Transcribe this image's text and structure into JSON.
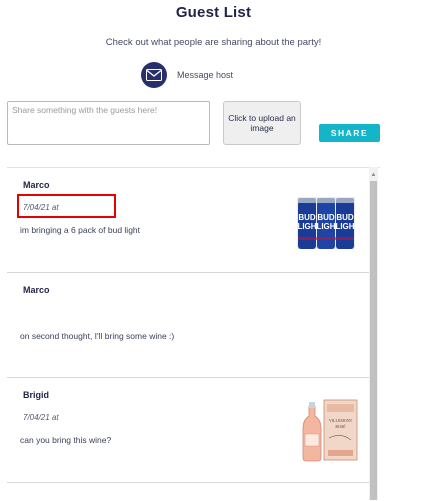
{
  "page": {
    "title": "Guest List",
    "subtitle": "Check out what people are sharing about the party!"
  },
  "message_host": {
    "label": "Message host",
    "icon": "envelope-icon",
    "icon_color": "#27306d"
  },
  "compose": {
    "placeholder": "Share something with the guests here!",
    "value": "",
    "upload_label": "Click to upload an image",
    "share_label": "SHARE",
    "share_color": "#15b5c9"
  },
  "posts": [
    {
      "author": "Marco",
      "timestamp": "7/04/21 at",
      "text": "im bringing a 6 pack of bud light",
      "image": "beer-six-pack-image",
      "highlighted": true
    },
    {
      "author": "Marco",
      "timestamp": "",
      "text": "on second thought, I'll bring some wine :)",
      "image": null,
      "highlighted": false
    },
    {
      "author": "Brigid",
      "timestamp": "7/04/21 at",
      "text": "can you bring this wine?",
      "image": "rose-wine-bottle-image",
      "highlighted": false
    }
  ],
  "colors": {
    "heading": "#1f2447",
    "highlight": "#e60000"
  }
}
